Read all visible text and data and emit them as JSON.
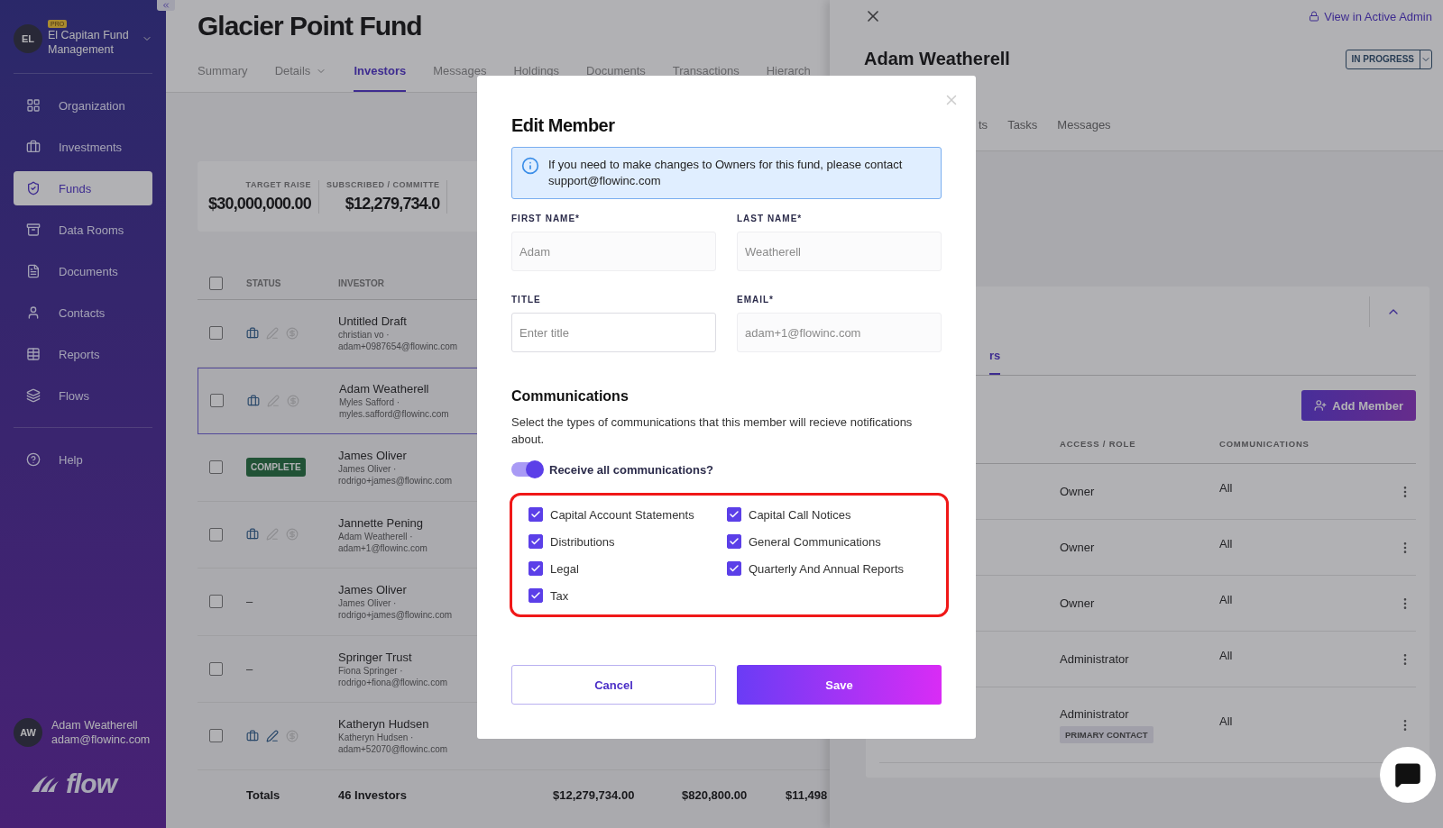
{
  "sidebar": {
    "org": {
      "initials": "EL",
      "badge": "PRO",
      "name": "El Capitan Fund Management"
    },
    "nav": [
      {
        "label": "Organization",
        "selected": false
      },
      {
        "label": "Investments",
        "selected": false
      },
      {
        "label": "Funds",
        "selected": true
      },
      {
        "label": "Data Rooms",
        "selected": false
      },
      {
        "label": "Documents",
        "selected": false
      },
      {
        "label": "Contacts",
        "selected": false
      },
      {
        "label": "Reports",
        "selected": false
      },
      {
        "label": "Flows",
        "selected": false
      }
    ],
    "help": {
      "label": "Help",
      "selected": false
    },
    "user": {
      "initials": "AW",
      "name": "Adam Weatherell",
      "email": "adam@flowinc.com"
    },
    "logo": "flow"
  },
  "page": {
    "title": "Glacier Point Fund",
    "tabs": [
      {
        "label": "Summary",
        "selected": false,
        "has_menu": false
      },
      {
        "label": "Details",
        "selected": false,
        "has_menu": true
      },
      {
        "label": "Investors",
        "selected": true,
        "has_menu": false
      },
      {
        "label": "Messages",
        "selected": false,
        "has_menu": false
      },
      {
        "label": "Holdings",
        "selected": false,
        "has_menu": false
      },
      {
        "label": "Documents",
        "selected": false,
        "has_menu": false
      },
      {
        "label": "Transactions",
        "selected": false,
        "has_menu": false
      },
      {
        "label": "Hierarch",
        "selected": false,
        "has_menu": false
      }
    ],
    "stats": [
      {
        "label": "TARGET RAISE",
        "value": "$30,000,000.00"
      },
      {
        "label": "SUBSCRIBED / COMMITTE",
        "value": "$12,279,734.0"
      }
    ],
    "table": {
      "select_all": {
        "checked": false
      },
      "columns": [
        "STATUS",
        "INVESTOR"
      ],
      "rows": [
        {
          "selected": false,
          "status": {
            "kind": "icons",
            "icons": [
              {
                "kind": "briefcase",
                "active": true
              },
              {
                "kind": "pen",
                "active": false
              },
              {
                "kind": "dollar",
                "active": false
              }
            ]
          },
          "name": "Untitled Draft",
          "contact": "christian vo ·",
          "email": "adam+0987654@flowinc.com"
        },
        {
          "selected": true,
          "status": {
            "kind": "icons",
            "icons": [
              {
                "kind": "briefcase",
                "active": true
              },
              {
                "kind": "pen",
                "active": false
              },
              {
                "kind": "dollar",
                "active": false
              }
            ]
          },
          "name": "Adam Weatherell",
          "contact": "Myles Safford ·",
          "email": "myles.safford@flowinc.com"
        },
        {
          "selected": false,
          "status": {
            "kind": "badge",
            "text": "COMPLETE"
          },
          "name": "James Oliver",
          "contact": "James Oliver ·",
          "email": "rodrigo+james@flowinc.com"
        },
        {
          "selected": false,
          "status": {
            "kind": "icons",
            "icons": [
              {
                "kind": "briefcase",
                "active": true
              },
              {
                "kind": "pen",
                "active": false
              },
              {
                "kind": "dollar",
                "active": false
              }
            ]
          },
          "name": "Jannette Pening",
          "contact": "Adam Weatherell ·",
          "email": "adam+1@flowinc.com"
        },
        {
          "selected": false,
          "status": {
            "kind": "dash",
            "text": "–"
          },
          "name": "James Oliver",
          "contact": "James Oliver ·",
          "email": "rodrigo+james@flowinc.com"
        },
        {
          "selected": false,
          "status": {
            "kind": "dash",
            "text": "–"
          },
          "name": "Springer Trust",
          "contact": "Fiona Springer ·",
          "email": "rodrigo+fiona@flowinc.com"
        },
        {
          "selected": false,
          "status": {
            "kind": "icons",
            "icons": [
              {
                "kind": "briefcase",
                "active": true
              },
              {
                "kind": "pen",
                "active": true
              },
              {
                "kind": "dollar",
                "active": false
              }
            ]
          },
          "name": "Katheryn Hudsen",
          "contact": "Katheryn Hudsen ·",
          "email": "adam+52070@flowinc.com"
        }
      ],
      "totals": [
        "Totals",
        "46 Investors",
        "$12,279,734.00",
        "$820,800.00",
        "$11,498"
      ]
    }
  },
  "panel": {
    "admin_link": "View in Active Admin",
    "title": "Adam Weatherell",
    "status": "IN PROGRESS",
    "tabs": [
      {
        "label": "ts"
      },
      {
        "label": "Tasks"
      },
      {
        "label": "Messages"
      }
    ],
    "card": {
      "tab": {
        "label": "rs",
        "selected": true
      },
      "add_button": "Add Member",
      "columns": [
        "ACCESS / ROLE",
        "COMMUNICATIONS"
      ],
      "members": [
        {
          "role": "Owner",
          "communications": "All"
        },
        {
          "role": "Owner",
          "communications": "All"
        },
        {
          "role": "Owner",
          "communications": "All"
        },
        {
          "role": "Administrator",
          "communications": "All"
        },
        {
          "role": "Administrator",
          "badge": "PRIMARY CONTACT",
          "communications": "All"
        }
      ]
    }
  },
  "modal": {
    "title": "Edit Member",
    "info": "If you need to make changes to Owners for this fund, please contact support@flowinc.com",
    "fields": [
      {
        "label": "FIRST NAME*",
        "value": "Adam",
        "disabled": true
      },
      {
        "label": "LAST NAME*",
        "value": "Weatherell",
        "disabled": true
      },
      {
        "label": "TITLE",
        "placeholder": "Enter title",
        "disabled": false
      },
      {
        "label": "EMAIL*",
        "value": "adam+1@flowinc.com",
        "disabled": true
      }
    ],
    "section": "Communications",
    "description": "Select the types of communications that this member will recieve notifications about.",
    "toggle": {
      "label": "Receive all communications?",
      "on": true
    },
    "options": [
      {
        "label": "Capital Account Statements",
        "checked": true
      },
      {
        "label": "Capital Call Notices",
        "checked": true
      },
      {
        "label": "Distributions",
        "checked": true
      },
      {
        "label": "General Communications",
        "checked": true
      },
      {
        "label": "Legal",
        "checked": true
      },
      {
        "label": "Quarterly And Annual Reports",
        "checked": true
      },
      {
        "label": "Tax",
        "checked": true
      }
    ],
    "cancel": "Cancel",
    "save": "Save"
  }
}
